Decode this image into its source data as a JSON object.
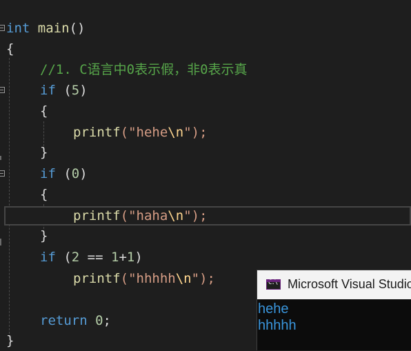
{
  "editor": {
    "lines": {
      "main_sig": {
        "type": "int",
        "name": "main",
        "parens": "()"
      },
      "open_brace": "{",
      "comment": "//1. C语言中0表示假，非0表示真",
      "if1": {
        "kw": "if",
        "open": " (",
        "num": "5",
        "close": ")"
      },
      "if1_open": "{",
      "printf1": {
        "fn": "printf",
        "open": "(\"",
        "str": "hehe",
        "esc": "\\n",
        "close": "\");"
      },
      "if1_close": "}",
      "if2": {
        "kw": "if",
        "open": " (",
        "num": "0",
        "close": ")"
      },
      "if2_open": "{",
      "printf2": {
        "fn": "printf",
        "open": "(\"",
        "str": "haha",
        "esc": "\\n",
        "close": "\");"
      },
      "if2_close": "}",
      "if3": {
        "kw": "if",
        "open": " (",
        "num1": "2",
        "op": " == ",
        "num2": "1",
        "plus": "+",
        "num3": "1",
        "close": ")"
      },
      "printf3": {
        "fn": "printf",
        "open": "(\"",
        "str": "hhhhh",
        "esc": "\\n",
        "close": "\");"
      },
      "return": {
        "kw": "return",
        "num": "0",
        "semi": ";"
      },
      "close_brace": "}"
    }
  },
  "console": {
    "title": "Microsoft Visual Studio",
    "icon": "console-app-icon",
    "output": [
      "hehe",
      "hhhhh"
    ]
  },
  "colors": {
    "background": "#1e1e1e",
    "keyword": "#569cd6",
    "function": "#dcdcaa",
    "string": "#d69d85",
    "escape": "#ffd68f",
    "number": "#b5cea8",
    "comment": "#57a64a",
    "console_text": "#3a96dd"
  }
}
